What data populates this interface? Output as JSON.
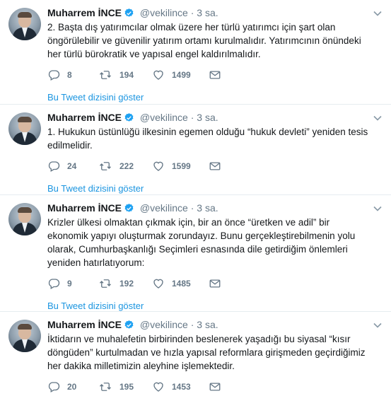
{
  "tweets": [
    {
      "name": "Muharrem İNCE",
      "handle": "@vekilince",
      "time": "3 sa.",
      "text": "2. Başta dış yatırımcılar olmak üzere her türlü yatırımcı için şart olan öngörülebilir ve güvenilir yatırım ortamı kurulmalıdır. Yatırımcının önündeki her türlü bürokratik ve yapısal engel kaldırılmalıdır.",
      "replies": "8",
      "retweets": "194",
      "likes": "1499",
      "thread_link": "Bu Tweet dizisini göster"
    },
    {
      "name": "Muharrem İNCE",
      "handle": "@vekilince",
      "time": "3 sa.",
      "text": "1. Hukukun üstünlüğü ilkesinin egemen olduğu “hukuk devleti” yeniden tesis edilmelidir.",
      "replies": "24",
      "retweets": "222",
      "likes": "1599",
      "thread_link": "Bu Tweet dizisini göster"
    },
    {
      "name": "Muharrem İNCE",
      "handle": "@vekilince",
      "time": "3 sa.",
      "text": "Krizler ülkesi olmaktan çıkmak için, bir an önce “üretken ve adil” bir ekonomik yapıyı oluşturmak zorundayız. Bunu gerçekleştirebilmenin yolu olarak, Cumhurbaşkanlığı Seçimleri esnasında dile getirdiğim önlemleri yeniden hatırlatıyorum:",
      "replies": "9",
      "retweets": "192",
      "likes": "1485",
      "thread_link": "Bu Tweet dizisini göster"
    },
    {
      "name": "Muharrem İNCE",
      "handle": "@vekilince",
      "time": "3 sa.",
      "text": "İktidarın ve muhalefetin birbirinden beslenerek yaşadığı bu siyasal “kısır döngüden” kurtulmadan ve hızla yapısal reformlara girişmeden geçirdiğimiz her dakika milletimizin aleyhine işlemektedir.",
      "replies": "20",
      "retweets": "195",
      "likes": "1453",
      "thread_link": ""
    }
  ],
  "icons": {
    "verified": "verified-badge-icon",
    "reply": "reply-icon",
    "retweet": "retweet-icon",
    "like": "heart-icon",
    "dm": "envelope-icon",
    "caret": "chevron-down-icon"
  },
  "colors": {
    "link": "#1b95e0",
    "verified": "#1da1f2",
    "muted": "#657786"
  }
}
